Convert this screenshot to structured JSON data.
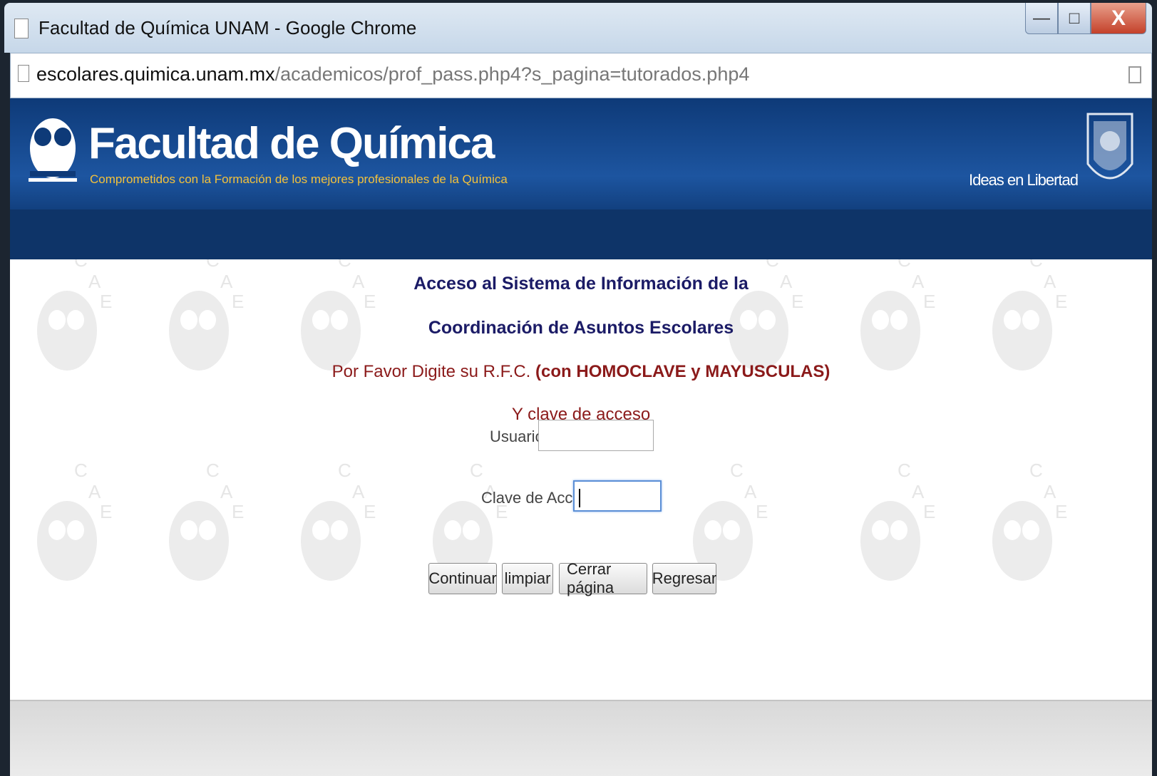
{
  "window": {
    "title": "Facultad de Química UNAM - Google Chrome",
    "controls": {
      "minimize": "—",
      "maximize": "□",
      "close": "X"
    }
  },
  "addressbar": {
    "host": "escolares.quimica.unam.mx",
    "path": "/academicos/prof_pass.php4?s_pagina=tutorados.php4"
  },
  "header": {
    "brand": "Facultad de Química",
    "tagline": "Comprometidos con la Formación de los mejores profesionales de la Química",
    "motto": "Ideas en Libertad",
    "bg_color": "#1d55a0",
    "tagline_color": "#f3c13b"
  },
  "form": {
    "heading_line1": "Acceso al Sistema de Información de la",
    "heading_line2": "Coordinación de Asuntos Escolares",
    "instruction_prefix": "Por Favor Digite su R.F.C. ",
    "instruction_bold": "(con HOMOCLAVE y MAYUSCULAS)",
    "instruction_line2": "Y clave de acceso",
    "user_label": "Usuario:",
    "user_value": "",
    "password_label": "Clave de Acceso:",
    "password_value": "",
    "buttons": {
      "continue": "Continuar",
      "clear": "limpiar",
      "close_page": "Cerrar página",
      "back": "Regresar"
    }
  }
}
